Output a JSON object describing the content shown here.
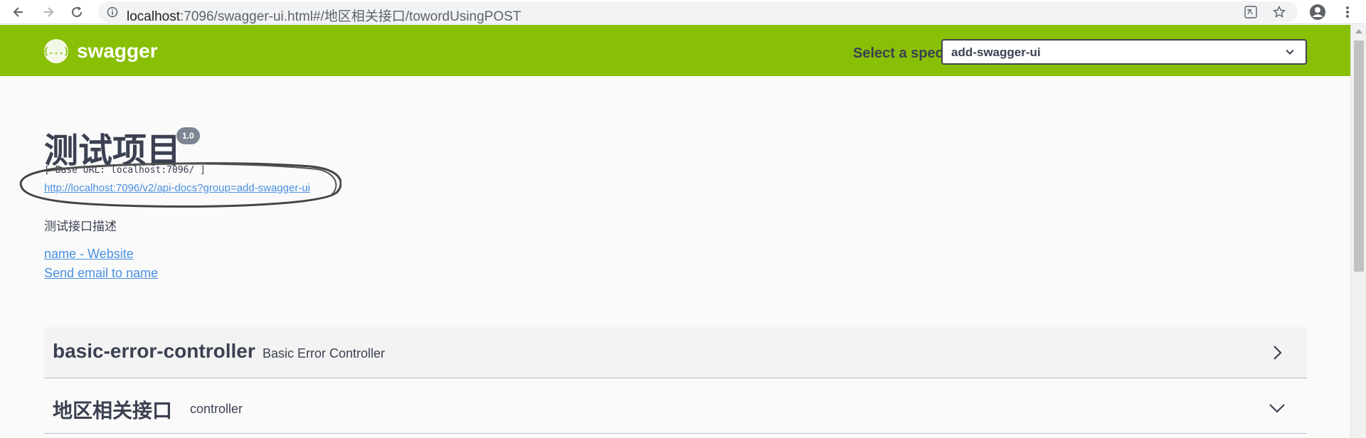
{
  "browser": {
    "url_host": "localhost",
    "url_rest": ":7096/swagger-ui.html#/地区相关接口/towordUsingPOST"
  },
  "topbar": {
    "logo_text": "swagger",
    "logo_glyph": "{...}",
    "select_label": "Select a spec",
    "select_value": "add-swagger-ui"
  },
  "info": {
    "title": "测试项目",
    "version": "1.0",
    "base_url": "[ Base URL: localhost:7096/ ]",
    "docs_link": "http://localhost:7096/v2/api-docs?group=add-swagger-ui",
    "description": "测试接口描述",
    "contact_website": "name - Website",
    "contact_email": "Send email to name"
  },
  "tags": [
    {
      "name": "basic-error-controller",
      "description": "Basic Error Controller"
    },
    {
      "name": "地区相关接口",
      "description": "controller"
    }
  ],
  "colors": {
    "topbar": "#89bf04",
    "text": "#3b4151",
    "link": "#4990e2",
    "annotation": "#444444"
  }
}
